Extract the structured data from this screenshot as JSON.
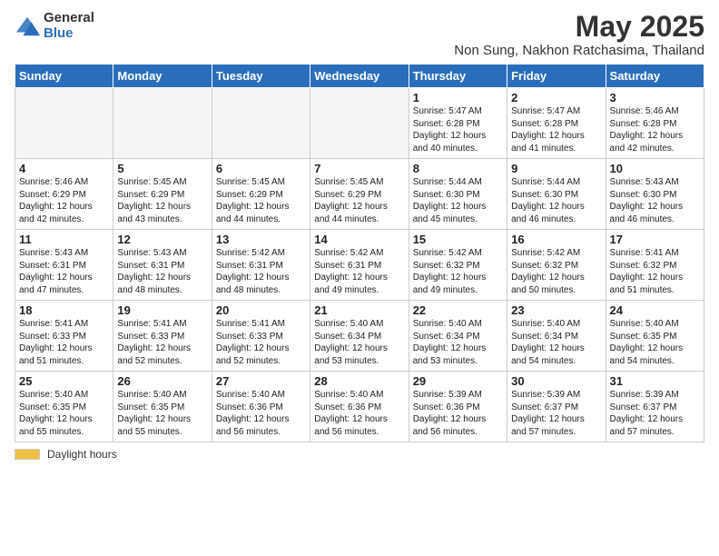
{
  "logo": {
    "general": "General",
    "blue": "Blue"
  },
  "title": "May 2025",
  "subtitle": "Non Sung, Nakhon Ratchasima, Thailand",
  "weekdays": [
    "Sunday",
    "Monday",
    "Tuesday",
    "Wednesday",
    "Thursday",
    "Friday",
    "Saturday"
  ],
  "footer": {
    "swatch_label": "Daylight hours"
  },
  "weeks": [
    [
      {
        "day": "",
        "info": ""
      },
      {
        "day": "",
        "info": ""
      },
      {
        "day": "",
        "info": ""
      },
      {
        "day": "",
        "info": ""
      },
      {
        "day": "1",
        "info": "Sunrise: 5:47 AM\nSunset: 6:28 PM\nDaylight: 12 hours\nand 40 minutes."
      },
      {
        "day": "2",
        "info": "Sunrise: 5:47 AM\nSunset: 6:28 PM\nDaylight: 12 hours\nand 41 minutes."
      },
      {
        "day": "3",
        "info": "Sunrise: 5:46 AM\nSunset: 6:28 PM\nDaylight: 12 hours\nand 42 minutes."
      }
    ],
    [
      {
        "day": "4",
        "info": "Sunrise: 5:46 AM\nSunset: 6:29 PM\nDaylight: 12 hours\nand 42 minutes."
      },
      {
        "day": "5",
        "info": "Sunrise: 5:45 AM\nSunset: 6:29 PM\nDaylight: 12 hours\nand 43 minutes."
      },
      {
        "day": "6",
        "info": "Sunrise: 5:45 AM\nSunset: 6:29 PM\nDaylight: 12 hours\nand 44 minutes."
      },
      {
        "day": "7",
        "info": "Sunrise: 5:45 AM\nSunset: 6:29 PM\nDaylight: 12 hours\nand 44 minutes."
      },
      {
        "day": "8",
        "info": "Sunrise: 5:44 AM\nSunset: 6:30 PM\nDaylight: 12 hours\nand 45 minutes."
      },
      {
        "day": "9",
        "info": "Sunrise: 5:44 AM\nSunset: 6:30 PM\nDaylight: 12 hours\nand 46 minutes."
      },
      {
        "day": "10",
        "info": "Sunrise: 5:43 AM\nSunset: 6:30 PM\nDaylight: 12 hours\nand 46 minutes."
      }
    ],
    [
      {
        "day": "11",
        "info": "Sunrise: 5:43 AM\nSunset: 6:31 PM\nDaylight: 12 hours\nand 47 minutes."
      },
      {
        "day": "12",
        "info": "Sunrise: 5:43 AM\nSunset: 6:31 PM\nDaylight: 12 hours\nand 48 minutes."
      },
      {
        "day": "13",
        "info": "Sunrise: 5:42 AM\nSunset: 6:31 PM\nDaylight: 12 hours\nand 48 minutes."
      },
      {
        "day": "14",
        "info": "Sunrise: 5:42 AM\nSunset: 6:31 PM\nDaylight: 12 hours\nand 49 minutes."
      },
      {
        "day": "15",
        "info": "Sunrise: 5:42 AM\nSunset: 6:32 PM\nDaylight: 12 hours\nand 49 minutes."
      },
      {
        "day": "16",
        "info": "Sunrise: 5:42 AM\nSunset: 6:32 PM\nDaylight: 12 hours\nand 50 minutes."
      },
      {
        "day": "17",
        "info": "Sunrise: 5:41 AM\nSunset: 6:32 PM\nDaylight: 12 hours\nand 51 minutes."
      }
    ],
    [
      {
        "day": "18",
        "info": "Sunrise: 5:41 AM\nSunset: 6:33 PM\nDaylight: 12 hours\nand 51 minutes."
      },
      {
        "day": "19",
        "info": "Sunrise: 5:41 AM\nSunset: 6:33 PM\nDaylight: 12 hours\nand 52 minutes."
      },
      {
        "day": "20",
        "info": "Sunrise: 5:41 AM\nSunset: 6:33 PM\nDaylight: 12 hours\nand 52 minutes."
      },
      {
        "day": "21",
        "info": "Sunrise: 5:40 AM\nSunset: 6:34 PM\nDaylight: 12 hours\nand 53 minutes."
      },
      {
        "day": "22",
        "info": "Sunrise: 5:40 AM\nSunset: 6:34 PM\nDaylight: 12 hours\nand 53 minutes."
      },
      {
        "day": "23",
        "info": "Sunrise: 5:40 AM\nSunset: 6:34 PM\nDaylight: 12 hours\nand 54 minutes."
      },
      {
        "day": "24",
        "info": "Sunrise: 5:40 AM\nSunset: 6:35 PM\nDaylight: 12 hours\nand 54 minutes."
      }
    ],
    [
      {
        "day": "25",
        "info": "Sunrise: 5:40 AM\nSunset: 6:35 PM\nDaylight: 12 hours\nand 55 minutes."
      },
      {
        "day": "26",
        "info": "Sunrise: 5:40 AM\nSunset: 6:35 PM\nDaylight: 12 hours\nand 55 minutes."
      },
      {
        "day": "27",
        "info": "Sunrise: 5:40 AM\nSunset: 6:36 PM\nDaylight: 12 hours\nand 56 minutes."
      },
      {
        "day": "28",
        "info": "Sunrise: 5:40 AM\nSunset: 6:36 PM\nDaylight: 12 hours\nand 56 minutes."
      },
      {
        "day": "29",
        "info": "Sunrise: 5:39 AM\nSunset: 6:36 PM\nDaylight: 12 hours\nand 56 minutes."
      },
      {
        "day": "30",
        "info": "Sunrise: 5:39 AM\nSunset: 6:37 PM\nDaylight: 12 hours\nand 57 minutes."
      },
      {
        "day": "31",
        "info": "Sunrise: 5:39 AM\nSunset: 6:37 PM\nDaylight: 12 hours\nand 57 minutes."
      }
    ]
  ]
}
